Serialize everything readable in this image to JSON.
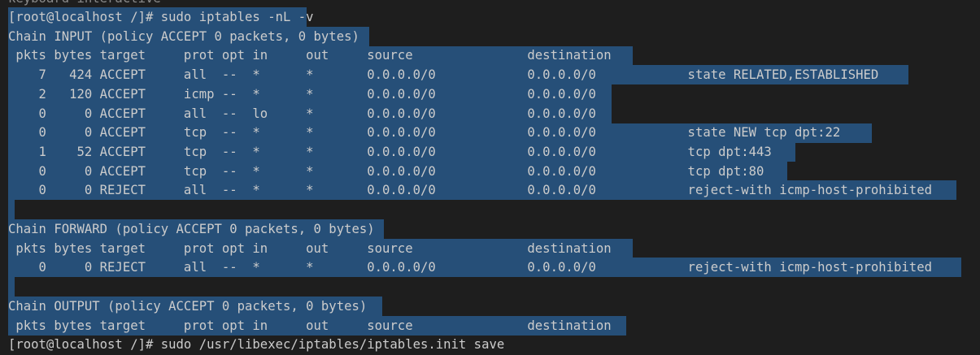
{
  "partial_top_line": "keyboard-interactive",
  "prompt_1": "[root@localhost /]# sudo iptables -nL -v",
  "chains": [
    {
      "header": "Chain INPUT (policy ACCEPT 0 packets, 0 bytes)",
      "columns": " pkts bytes target     prot opt in     out     source               destination",
      "rows": [
        "    7   424 ACCEPT     all  --  *      *       0.0.0.0/0            0.0.0.0/0            state RELATED,ESTABLISHED",
        "    2   120 ACCEPT     icmp --  *      *       0.0.0.0/0            0.0.0.0/0",
        "    0     0 ACCEPT     all  --  lo     *       0.0.0.0/0            0.0.0.0/0",
        "    0     0 ACCEPT     tcp  --  *      *       0.0.0.0/0            0.0.0.0/0            state NEW tcp dpt:22",
        "    1    52 ACCEPT     tcp  --  *      *       0.0.0.0/0            0.0.0.0/0            tcp dpt:443",
        "    0     0 ACCEPT     tcp  --  *      *       0.0.0.0/0            0.0.0.0/0            tcp dpt:80",
        "    0     0 REJECT     all  --  *      *       0.0.0.0/0            0.0.0.0/0            reject-with icmp-host-prohibited"
      ]
    },
    {
      "header": "Chain FORWARD (policy ACCEPT 0 packets, 0 bytes)",
      "columns": " pkts bytes target     prot opt in     out     source               destination",
      "rows": [
        "    0     0 REJECT     all  --  *      *       0.0.0.0/0            0.0.0.0/0            reject-with icmp-host-prohibited"
      ]
    },
    {
      "header": "Chain OUTPUT (policy ACCEPT 0 packets, 0 bytes)",
      "columns": " pkts bytes target     prot opt in     out     source               destination",
      "rows": []
    }
  ],
  "prompt_2": "[root@localhost /]# sudo /usr/libexec/iptables/iptables.init save",
  "colors": {
    "background": "#1e1e1e",
    "selection": "#264f78",
    "text": "#cccccc"
  }
}
